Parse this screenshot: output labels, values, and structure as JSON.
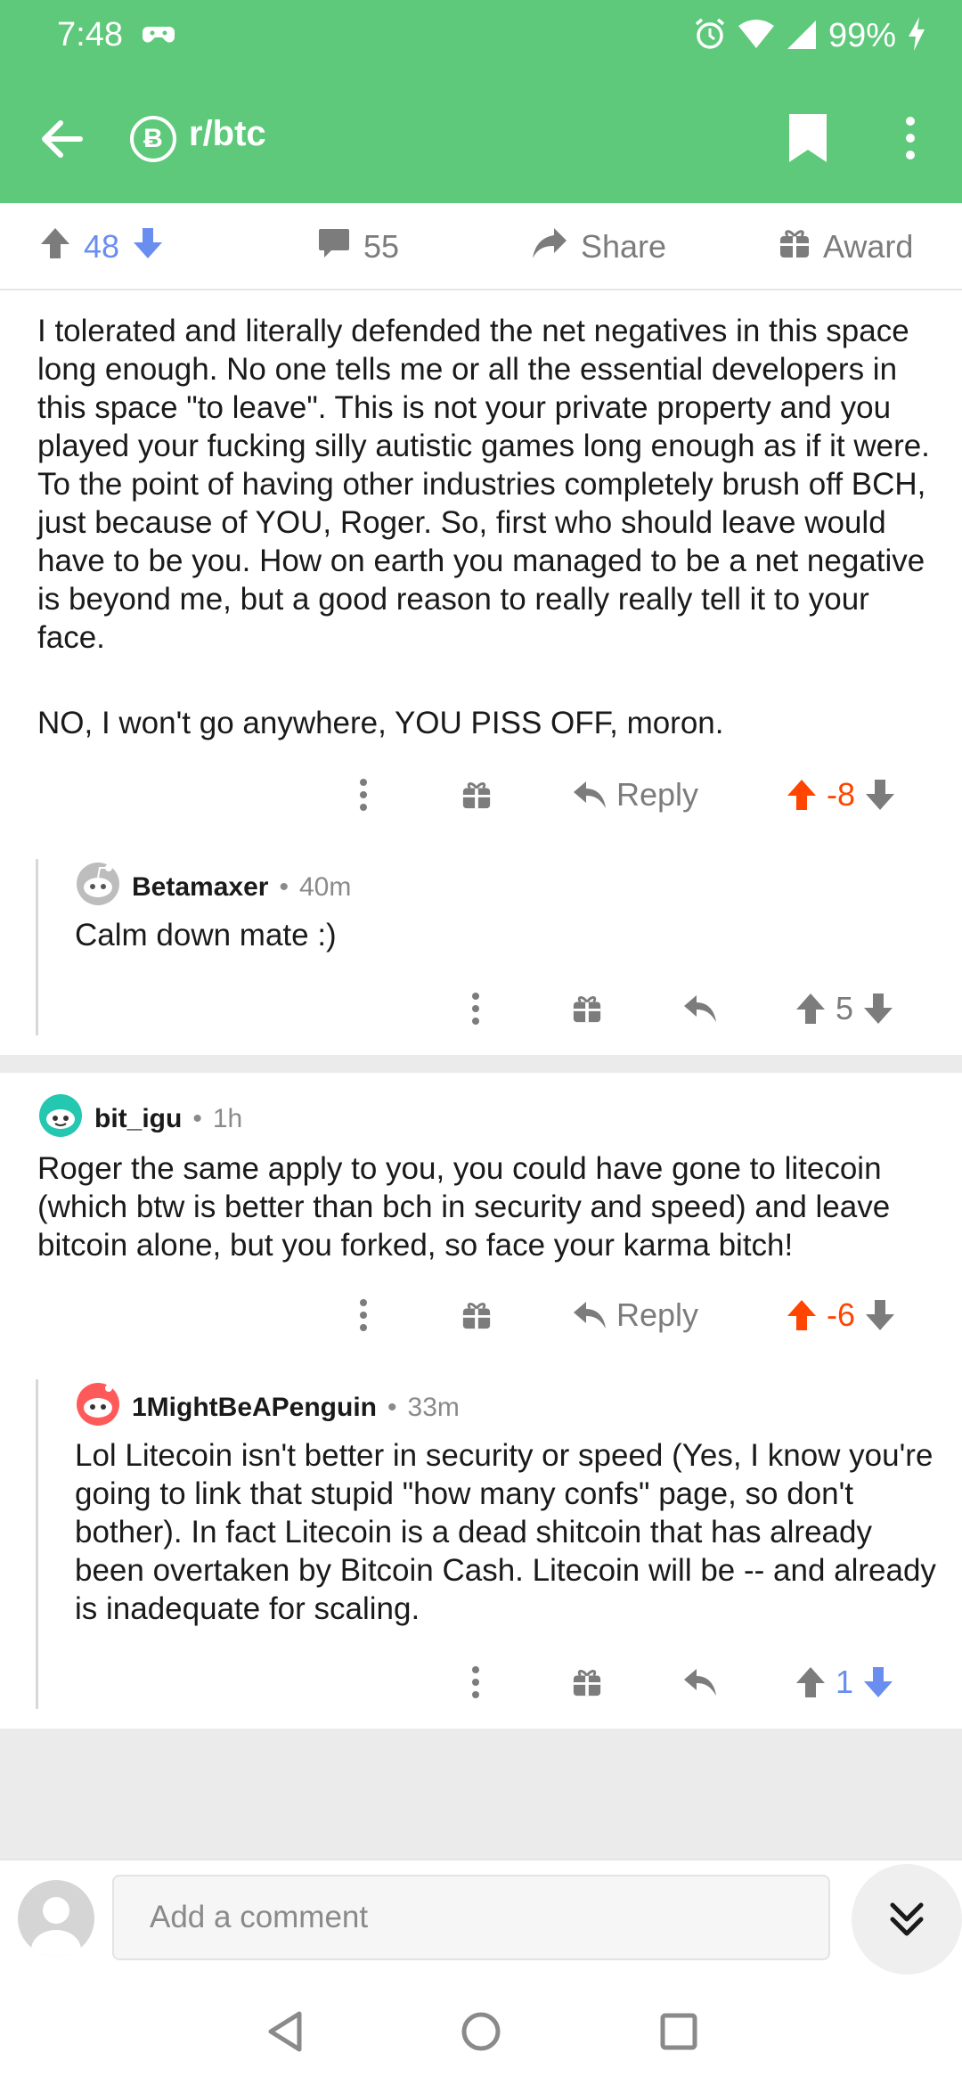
{
  "status_bar": {
    "time": "7:48",
    "battery": "99%"
  },
  "toolbar": {
    "subreddit": "r/btc",
    "sub_icon": "Ƀ"
  },
  "post_actions": {
    "votes": "48",
    "comments": "55",
    "share": "Share",
    "award": "Award"
  },
  "comments": [
    {
      "body_p1": "I tolerated and literally defended the net negatives in this space long enough. No one tells me or all the essential developers in this space \"to leave\". This is not your private property and you played your fucking silly autistic games long enough as if it were. To the point of having other industries completely brush off BCH, just because of YOU, Roger. So, first who should leave would have to be you. How on earth you managed to be a net negative is beyond me, but a good reason to really really tell it to your face.",
      "body_p2": "NO, I won't go anywhere, YOU PISS OFF, moron.",
      "reply_label": "Reply",
      "score": "-8"
    },
    {
      "author": "Betamaxer",
      "time": "40m",
      "body": "Calm down mate :)",
      "score": "5"
    },
    {
      "author": "bit_igu",
      "time": "1h",
      "body": "Roger the same apply to you, you could have gone to litecoin (which btw is better than bch in security and speed) and leave bitcoin alone, but you forked, so face your karma bitch!",
      "reply_label": "Reply",
      "score": "-6"
    },
    {
      "author": "1MightBeAPenguin",
      "time": "33m",
      "body": "Lol Litecoin isn't better in security or speed (Yes, I know you're going to link that stupid \"how many confs\" page, so don't bother). In fact Litecoin is a dead shitcoin that has already been overtaken by Bitcoin Cash. Litecoin will be -- and already is inadequate for scaling.",
      "score": "1"
    }
  ],
  "composer": {
    "placeholder": "Add a comment"
  },
  "colors": {
    "header": "#5ec97a",
    "upvote": "#ff4500",
    "downvote": "#6a8ef0"
  }
}
